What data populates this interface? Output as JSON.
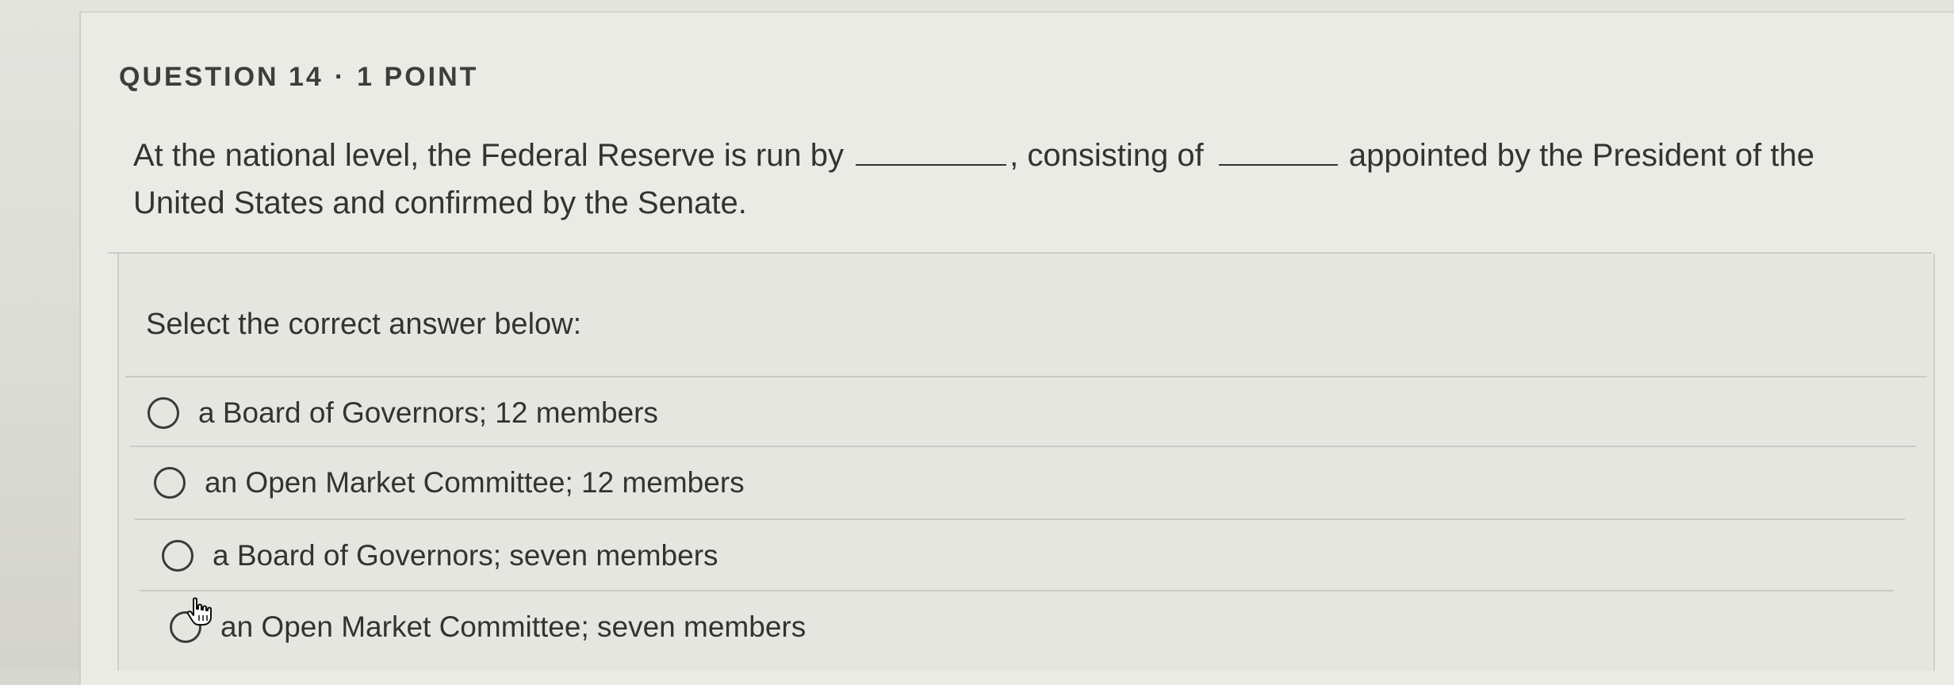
{
  "question": {
    "number_label": "QUESTION 14",
    "separator": "·",
    "points_label": "1 POINT",
    "prompt_part1": "At the national level, the Federal Reserve is run by",
    "prompt_part2": ", consisting of",
    "prompt_part3": "appointed by the President of the United States and confirmed by the Senate."
  },
  "instruction": "Select the correct answer below:",
  "options": [
    {
      "label": "a Board of Governors; 12 members",
      "selected": false
    },
    {
      "label": "an Open Market Committee; 12 members",
      "selected": false
    },
    {
      "label": "a Board of Governors; seven members",
      "selected": false
    },
    {
      "label": "an Open Market Committee; seven members",
      "selected": false
    }
  ],
  "cursor_icon": "hand-pointer-icon"
}
